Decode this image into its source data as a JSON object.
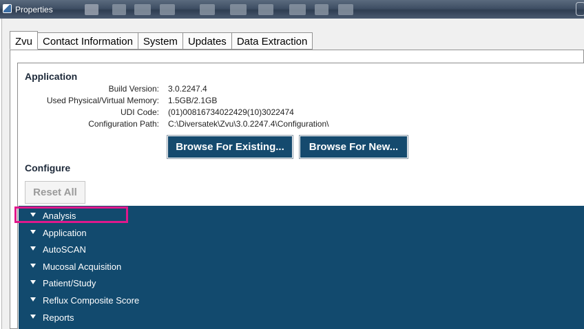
{
  "window": {
    "title": "Properties",
    "toolbar_icons": [
      "bar-chart-icon",
      "grid-icon",
      "camera-icon",
      "image-icon",
      "record-icon",
      "table-icon",
      "report-icon",
      "page-icon",
      "search-icon",
      "document-icon"
    ]
  },
  "tabs": [
    {
      "label": "Zvu",
      "active": true
    },
    {
      "label": "Contact Information",
      "active": false
    },
    {
      "label": "System",
      "active": false
    },
    {
      "label": "Updates",
      "active": false
    },
    {
      "label": "Data Extraction",
      "active": false
    }
  ],
  "application": {
    "heading": "Application",
    "build_version_label": "Build Version:",
    "build_version": "3.0.2247.4",
    "memory_label": "Used Physical/Virtual Memory:",
    "memory": "1.5GB/2.1GB",
    "udi_label": "UDI Code:",
    "udi": "(01)00816734022429(10)3022474",
    "config_path_label": "Configuration Path:",
    "config_path": "C:\\Diversatek\\Zvu\\3.0.2247.4\\Configuration\\",
    "browse_existing_label": "Browse For Existing...",
    "browse_new_label": "Browse For New..."
  },
  "configure": {
    "heading": "Configure",
    "reset_label": "Reset All",
    "items": [
      "Analysis",
      "Application",
      "AutoSCAN",
      "Mucosal Acquisition",
      "Patient/Study",
      "Reflux Composite Score",
      "Reports"
    ]
  },
  "colors": {
    "accent": "#124a6e",
    "highlight": "#e0188c",
    "titlebar": "#3f4f64"
  }
}
